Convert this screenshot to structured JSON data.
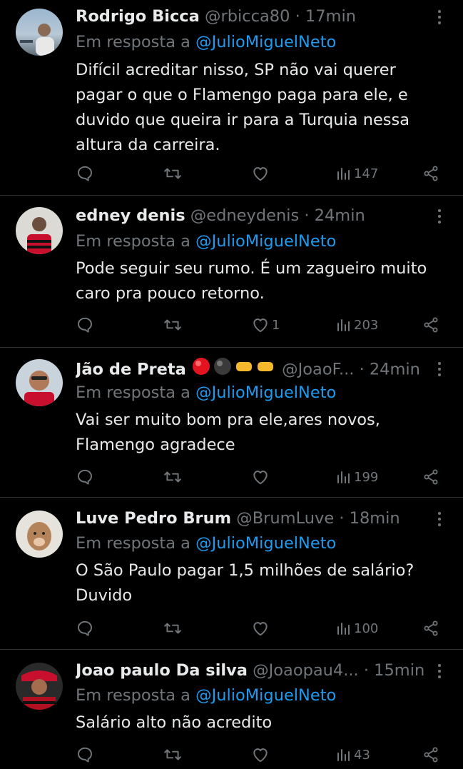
{
  "tweets": [
    {
      "name": "Rodrigo Bicca",
      "handle": "@rbicca80",
      "time": "· 17min",
      "reply_prefix": "Em resposta a",
      "reply_to": "@JulioMiguelNeto",
      "text": "Difícil acreditar nisso, SP não vai querer pagar o que o Flamengo paga para ele, e duvido que queira ir para a Turquia nessa altura da carreira.",
      "likes": "",
      "views": "147"
    },
    {
      "name": "edney denis",
      "handle": "@edneydenis",
      "time": "· 24min",
      "reply_prefix": "Em resposta a",
      "reply_to": "@JulioMiguelNeto",
      "text": "Pode seguir seu rumo. É um zagueiro muito caro pra pouco retorno.",
      "likes": "1",
      "views": "203"
    },
    {
      "name": "Jão de Preta",
      "handle": "@JoaoF...",
      "time": "· 24min",
      "reply_prefix": "Em resposta a",
      "reply_to": "@JulioMiguelNeto",
      "text": "Vai ser muito bom pra ele,ares novos, Flamengo agradece",
      "likes": "",
      "views": "199"
    },
    {
      "name": "Luve Pedro Brum",
      "handle": "@BrumLuve",
      "time": "· 18min",
      "reply_prefix": "Em resposta a",
      "reply_to": "@JulioMiguelNeto",
      "text": "O São Paulo pagar 1,5 milhões de salário? Duvido",
      "likes": "",
      "views": "100"
    },
    {
      "name": "Joao paulo Da silva",
      "handle": "@Joaopau4...",
      "time": "· 15min",
      "reply_prefix": "Em resposta a",
      "reply_to": "@JulioMiguelNeto",
      "text": "Salário alto não acredito",
      "likes": "",
      "views": "43"
    }
  ],
  "icons": {
    "reply": "reply-icon",
    "retweet": "retweet-icon",
    "like": "heart-icon",
    "views": "views-icon",
    "share": "share-icon",
    "more": "more-icon"
  },
  "colors": {
    "background": "#000000",
    "text": "#e7e9ea",
    "muted": "#71767b",
    "mention": "#1d9bf0",
    "divider": "#2f3336"
  }
}
